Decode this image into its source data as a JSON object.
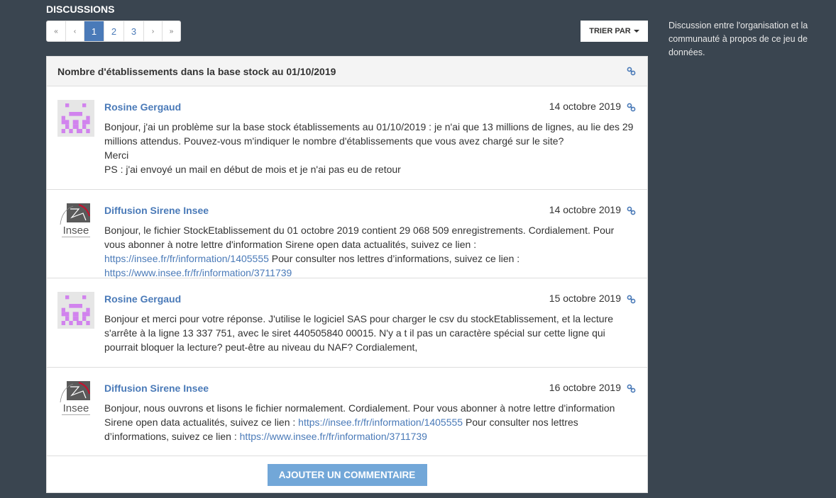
{
  "section_title": "DISCUSSIONS",
  "pagination": {
    "first": "«",
    "prev": "‹",
    "pages": [
      "1",
      "2",
      "3"
    ],
    "current": "1",
    "next": "›",
    "last": "»"
  },
  "sort_label": "TRIER PAR",
  "aside_text": "Discussion entre l'organisation et la communauté à propos de ce jeu de données.",
  "discussion": {
    "title": "Nombre d'établissements dans la base stock au 01/10/2019",
    "comments": [
      {
        "author": "Rosine Gergaud",
        "date": "14 octobre 2019",
        "avatar": "identicon",
        "lines": [
          "Bonjour, j'ai un problème sur la base stock établissements au 01/10/2019 : je n'ai que 13 millions de lignes, au lie des 29 millions attendus. Pouvez-vous m'indiquer le nombre d'établissements que vous avez chargé sur le site?",
          "Merci",
          "PS : j'ai envoyé un mail en début de mois et je n'ai pas eu de retour"
        ]
      },
      {
        "author": "Diffusion Sirene Insee",
        "date": "14 octobre 2019",
        "avatar": "insee-logo",
        "text1": "Bonjour, le fichier StockEtablissement du 01 octobre 2019 contient 29 068 509 enregistrements. Cordialement. Pour vous abonner à notre lettre d'information Sirene open data actualités, suivez ce lien : ",
        "link1": "https://insee.fr/fr/information/1405555",
        "text2": " Pour consulter nos lettres d’informations, suivez ce lien : ",
        "link2": "https://www.insee.fr/fr/information/3711739"
      },
      {
        "author": "Rosine Gergaud",
        "date": "15 octobre 2019",
        "avatar": "identicon",
        "lines": [
          "Bonjour et merci pour votre réponse. J'utilise le logiciel SAS pour charger le csv du stockEtablissement, et la lecture s'arrête à la ligne 13 337 751, avec le siret 440505840 00015. N'y a t il pas un caractère spécial sur cette ligne qui pourrait bloquer la lecture? peut-être au niveau du NAF? Cordialement,"
        ]
      },
      {
        "author": "Diffusion Sirene Insee",
        "date": "16 octobre 2019",
        "avatar": "insee-logo",
        "text1": "Bonjour, nous ouvrons et lisons le fichier normalement. Cordialement. Pour vous abonner à notre lettre d'information Sirene open data actualités, suivez ce lien : ",
        "link1": "https://insee.fr/fr/information/1405555",
        "text2": " Pour consulter nos lettres d’informations, suivez ce lien : ",
        "link2": "https://www.insee.fr/fr/information/3711739"
      }
    ]
  },
  "add_comment_label": "AJOUTER UN COMMENTAIRE",
  "insee_logo_text": "Insee",
  "colors": {
    "background": "#3a4550",
    "accent": "#4a7ab8",
    "button": "#72a7d8",
    "identicon": "#d183ee"
  }
}
